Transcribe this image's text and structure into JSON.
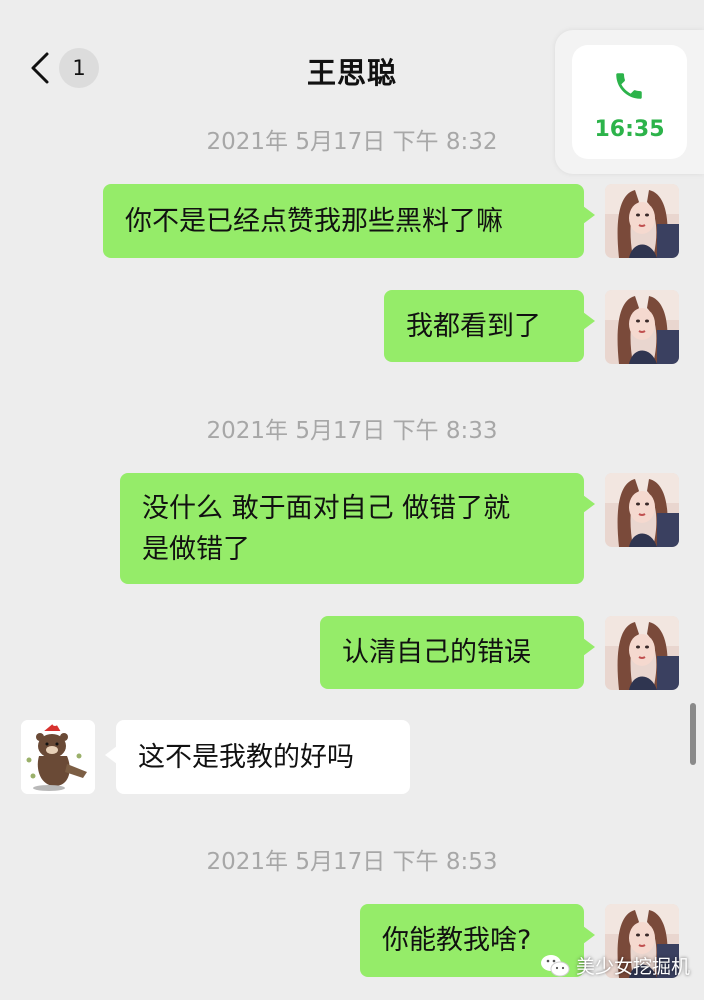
{
  "header": {
    "back_badge": "1",
    "title": "王思聪"
  },
  "call": {
    "time": "16:35",
    "icon": "phone-icon",
    "accent": "#2cb34a"
  },
  "messages": [
    {
      "type": "timestamp",
      "text": "2021年 5月17日 下午 8:32"
    },
    {
      "type": "outgoing",
      "text": "你不是已经点赞我那些黑料了嘛"
    },
    {
      "type": "outgoing",
      "text": "我都看到了"
    },
    {
      "type": "timestamp",
      "text": "2021年 5月17日 下午 8:33"
    },
    {
      "type": "outgoing",
      "lines": [
        "没什么 敢于面对自己 做错了就",
        "是做错了"
      ]
    },
    {
      "type": "outgoing",
      "text": "认清自己的错误"
    },
    {
      "type": "incoming",
      "text": "这不是我教的好吗"
    },
    {
      "type": "timestamp",
      "text": "2021年 5月17日 下午 8:53"
    },
    {
      "type": "outgoing",
      "text": "你能教我啥?"
    }
  ],
  "watermark": {
    "text": "美少女挖掘机"
  },
  "colors": {
    "background": "#ededed",
    "outgoing_bubble": "#95ec69",
    "incoming_bubble": "#ffffff",
    "timestamp": "#a7a7a7"
  }
}
